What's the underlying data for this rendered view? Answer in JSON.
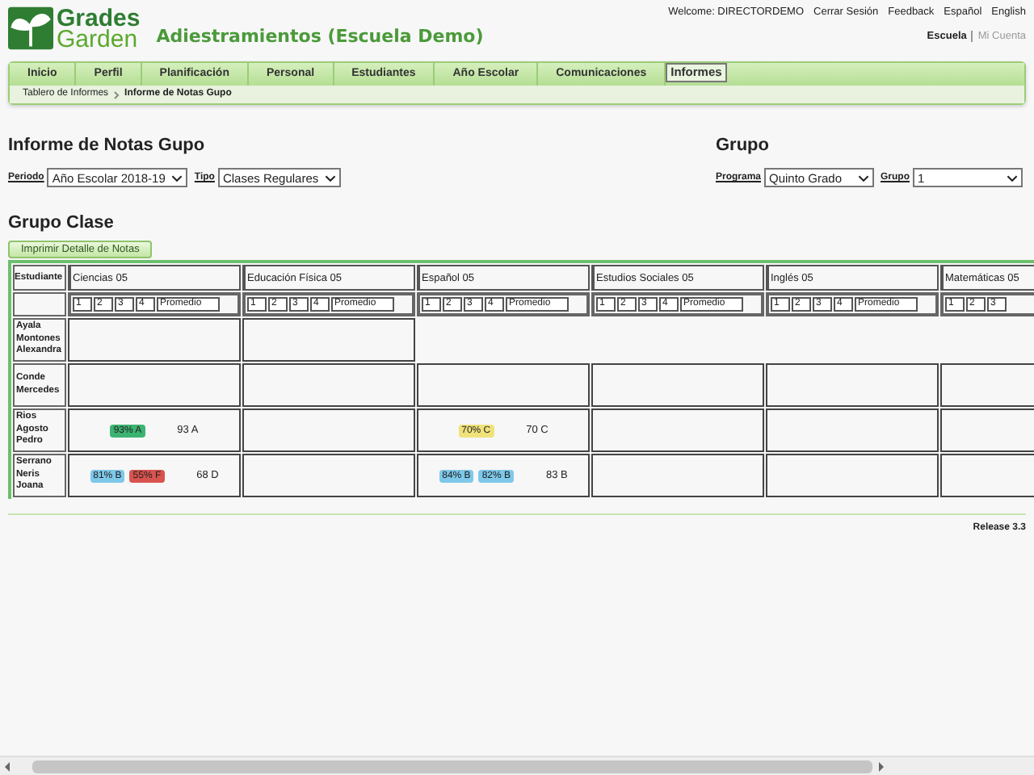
{
  "logo": {
    "line1": "Grades",
    "line2": "Garden"
  },
  "school_title": "Adiestramientos (Escuela Demo)",
  "top_links": [
    "Welcome: DIRECTORDEMO",
    "Cerrar Sesión",
    "Feedback",
    "Español",
    "English"
  ],
  "account_links": [
    {
      "label": "Escuela",
      "selected": true
    },
    {
      "label": "Mi Cuenta",
      "selected": false
    }
  ],
  "tabs": [
    {
      "label": "Inicio",
      "selected": false
    },
    {
      "label": "Perfil",
      "selected": false
    },
    {
      "label": "Planificación",
      "selected": false
    },
    {
      "label": "Personal",
      "selected": false
    },
    {
      "label": "Estudiantes",
      "selected": false
    },
    {
      "label": "Año Escolar",
      "selected": false
    },
    {
      "label": "Comunicaciones",
      "selected": false
    },
    {
      "label": "Informes",
      "selected": true
    }
  ],
  "breadcrumb": [
    "Tablero de Informes",
    "Informe de Notas Gupo"
  ],
  "report": {
    "title": "Informe de Notas Gupo",
    "filters": [
      {
        "label": "Periodo",
        "value": "Año Escolar 2018-19"
      },
      {
        "label": "Tipo",
        "value": "Clases Regulares"
      }
    ]
  },
  "group": {
    "title": "Grupo",
    "filters": [
      {
        "label": "Programa",
        "value": "Quinto Grado"
      },
      {
        "label": "Grupo",
        "value": "1"
      }
    ]
  },
  "class_group": {
    "title": "Grupo Clase",
    "print_button": "Imprimir Detalle de Notas"
  },
  "table": {
    "student_header": "Estudiante",
    "courses": [
      {
        "name": "Ciencias 05",
        "subheaders": [
          "1",
          "2",
          "3",
          "4",
          "Promedio"
        ]
      },
      {
        "name": "Educación Física 05",
        "subheaders": [
          "1",
          "2",
          "3",
          "4",
          "Promedio"
        ]
      },
      {
        "name": "Español 05",
        "subheaders": [
          "1",
          "2",
          "3",
          "4",
          "Promedio"
        ]
      },
      {
        "name": "Estudios Sociales 05",
        "subheaders": [
          "1",
          "2",
          "3",
          "4",
          "Promedio"
        ]
      },
      {
        "name": "Inglés 05",
        "subheaders": [
          "1",
          "2",
          "3",
          "4",
          "Promedio"
        ]
      },
      {
        "name": "Matemáticas 05",
        "subheaders": [
          "1",
          "2",
          "3"
        ]
      }
    ],
    "rows": [
      {
        "student": "Ayala Montones Alexandra",
        "cells": [
          {},
          {}
        ]
      },
      {
        "student": "Conde Mercedes",
        "cells": [
          {},
          {},
          {},
          {},
          {},
          {}
        ]
      },
      {
        "student": "Rios Agosto Pedro",
        "cells": [
          {
            "badges": [
              {
                "label": "93% A",
                "color": "#3cb371"
              }
            ],
            "average": "93 A"
          },
          {},
          {
            "badges": [
              {
                "label": "70% C",
                "color": "#f0e27a"
              }
            ],
            "average": "70 C"
          },
          {},
          {},
          {}
        ]
      },
      {
        "student": "Serrano Neris Joana",
        "cells": [
          {
            "badges": [
              {
                "label": "81% B",
                "color": "#7ec8ea"
              },
              {
                "label": "55% F",
                "color": "#d9534f"
              }
            ],
            "average": "68 D"
          },
          {},
          {
            "badges": [
              {
                "label": "84% B",
                "color": "#7ec8ea"
              },
              {
                "label": "82% B",
                "color": "#7ec8ea"
              }
            ],
            "average": "83 B"
          },
          {},
          {},
          {}
        ]
      }
    ]
  },
  "footer": {
    "release": "Release 3.3"
  }
}
